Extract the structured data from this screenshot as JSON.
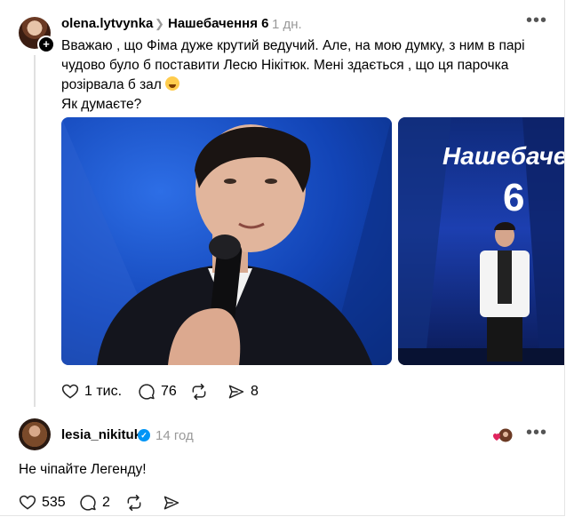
{
  "post": {
    "username": "olena.lytvynka",
    "topic": "Нашебачення 6",
    "time": "1 дн.",
    "text_line1": "Вважаю , що Фіма дуже крутий ведучий. Але, на мою думку, з ним в парі",
    "text_line2": "чудово було б поставити Лесю Нікітюк. Мені здається , що ця парочка",
    "text_line3": "розірвала б зал",
    "text_line4": "Як думаєте?",
    "image2_logo": "Нашебачення",
    "image2_number": "6",
    "likes": "1 тис.",
    "comments": "76",
    "shares": "8"
  },
  "reply": {
    "username": "lesia_nikituk",
    "time": "14 год",
    "text": "Не чіпайте Легенду!",
    "likes": "535",
    "comments": "2"
  },
  "icons": {
    "more": "more-icon",
    "like": "heart-icon",
    "comment": "comment-icon",
    "repost": "repost-icon",
    "share": "send-icon",
    "verified": "verified-badge-icon"
  },
  "colors": {
    "verified": "#0095f6",
    "liked_heart": "#e0245e",
    "muted_text": "#999999"
  }
}
